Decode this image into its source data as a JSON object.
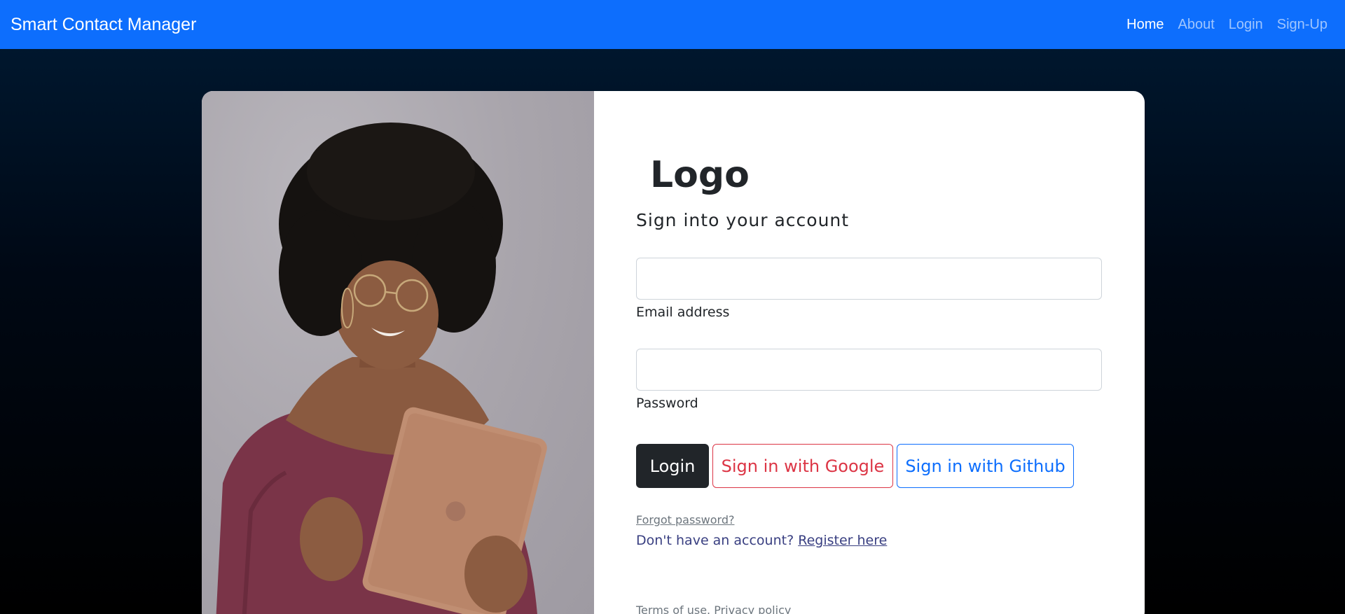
{
  "navbar": {
    "brand": "Smart Contact Manager",
    "links": [
      {
        "label": "Home",
        "active": true
      },
      {
        "label": "About",
        "active": false
      },
      {
        "label": "Login",
        "active": false
      },
      {
        "label": "Sign-Up",
        "active": false
      }
    ]
  },
  "form": {
    "logo": "Logo",
    "subtitle": "Sign into your account",
    "email_label": "Email address",
    "email_value": "",
    "password_label": "Password",
    "password_value": "",
    "login_button": "Login",
    "google_button": "Sign in with Google",
    "github_button": "Sign in with Github",
    "forgot_password": "Forgot password?",
    "no_account_text": "Don't have an account?",
    "register_link": "Register here",
    "terms": "Terms of use.",
    "privacy": "Privacy policy"
  },
  "colors": {
    "navbar_bg": "#0d6efd",
    "login_btn": "#212529",
    "google_btn": "#dc3545",
    "github_btn": "#0d6efd",
    "register_text": "#393f81"
  },
  "illustration": {
    "icon": "person-with-tablet-photo"
  }
}
